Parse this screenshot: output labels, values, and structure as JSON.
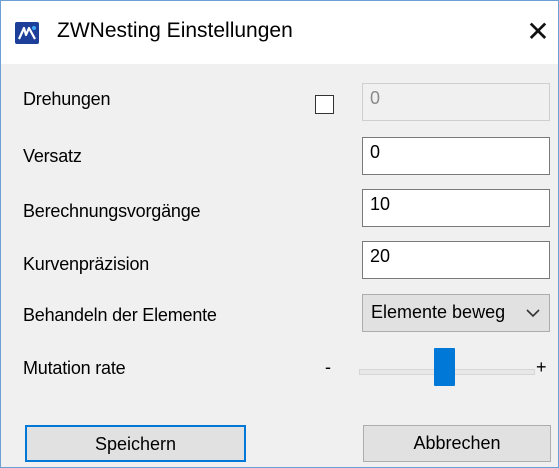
{
  "window": {
    "title": "ZWNesting Einstellungen",
    "close_glyph": "✕"
  },
  "fields": {
    "rotations": {
      "label": "Drehungen",
      "checked": false,
      "value": "0"
    },
    "offset": {
      "label": "Versatz",
      "value": "0"
    },
    "iterations": {
      "label": "Berechnungsvorgänge",
      "value": "10"
    },
    "curve_precision": {
      "label": "Kurvenpräzision",
      "value": "20"
    },
    "element_handling": {
      "label": "Behandeln der Elemente",
      "selected": "Elemente beweg"
    },
    "mutation_rate": {
      "label": "Mutation rate",
      "min_symbol": "-",
      "max_symbol": "+",
      "level": 0.45
    }
  },
  "buttons": {
    "save": "Speichern",
    "cancel": "Abbrechen"
  },
  "colors": {
    "accent": "#0078d7",
    "window_border": "#6d9fd6",
    "background": "#f0f0f0"
  },
  "icons": {
    "app": "zwnesting-app-icon",
    "close": "close-icon",
    "dropdown": "chevron-down-icon"
  }
}
